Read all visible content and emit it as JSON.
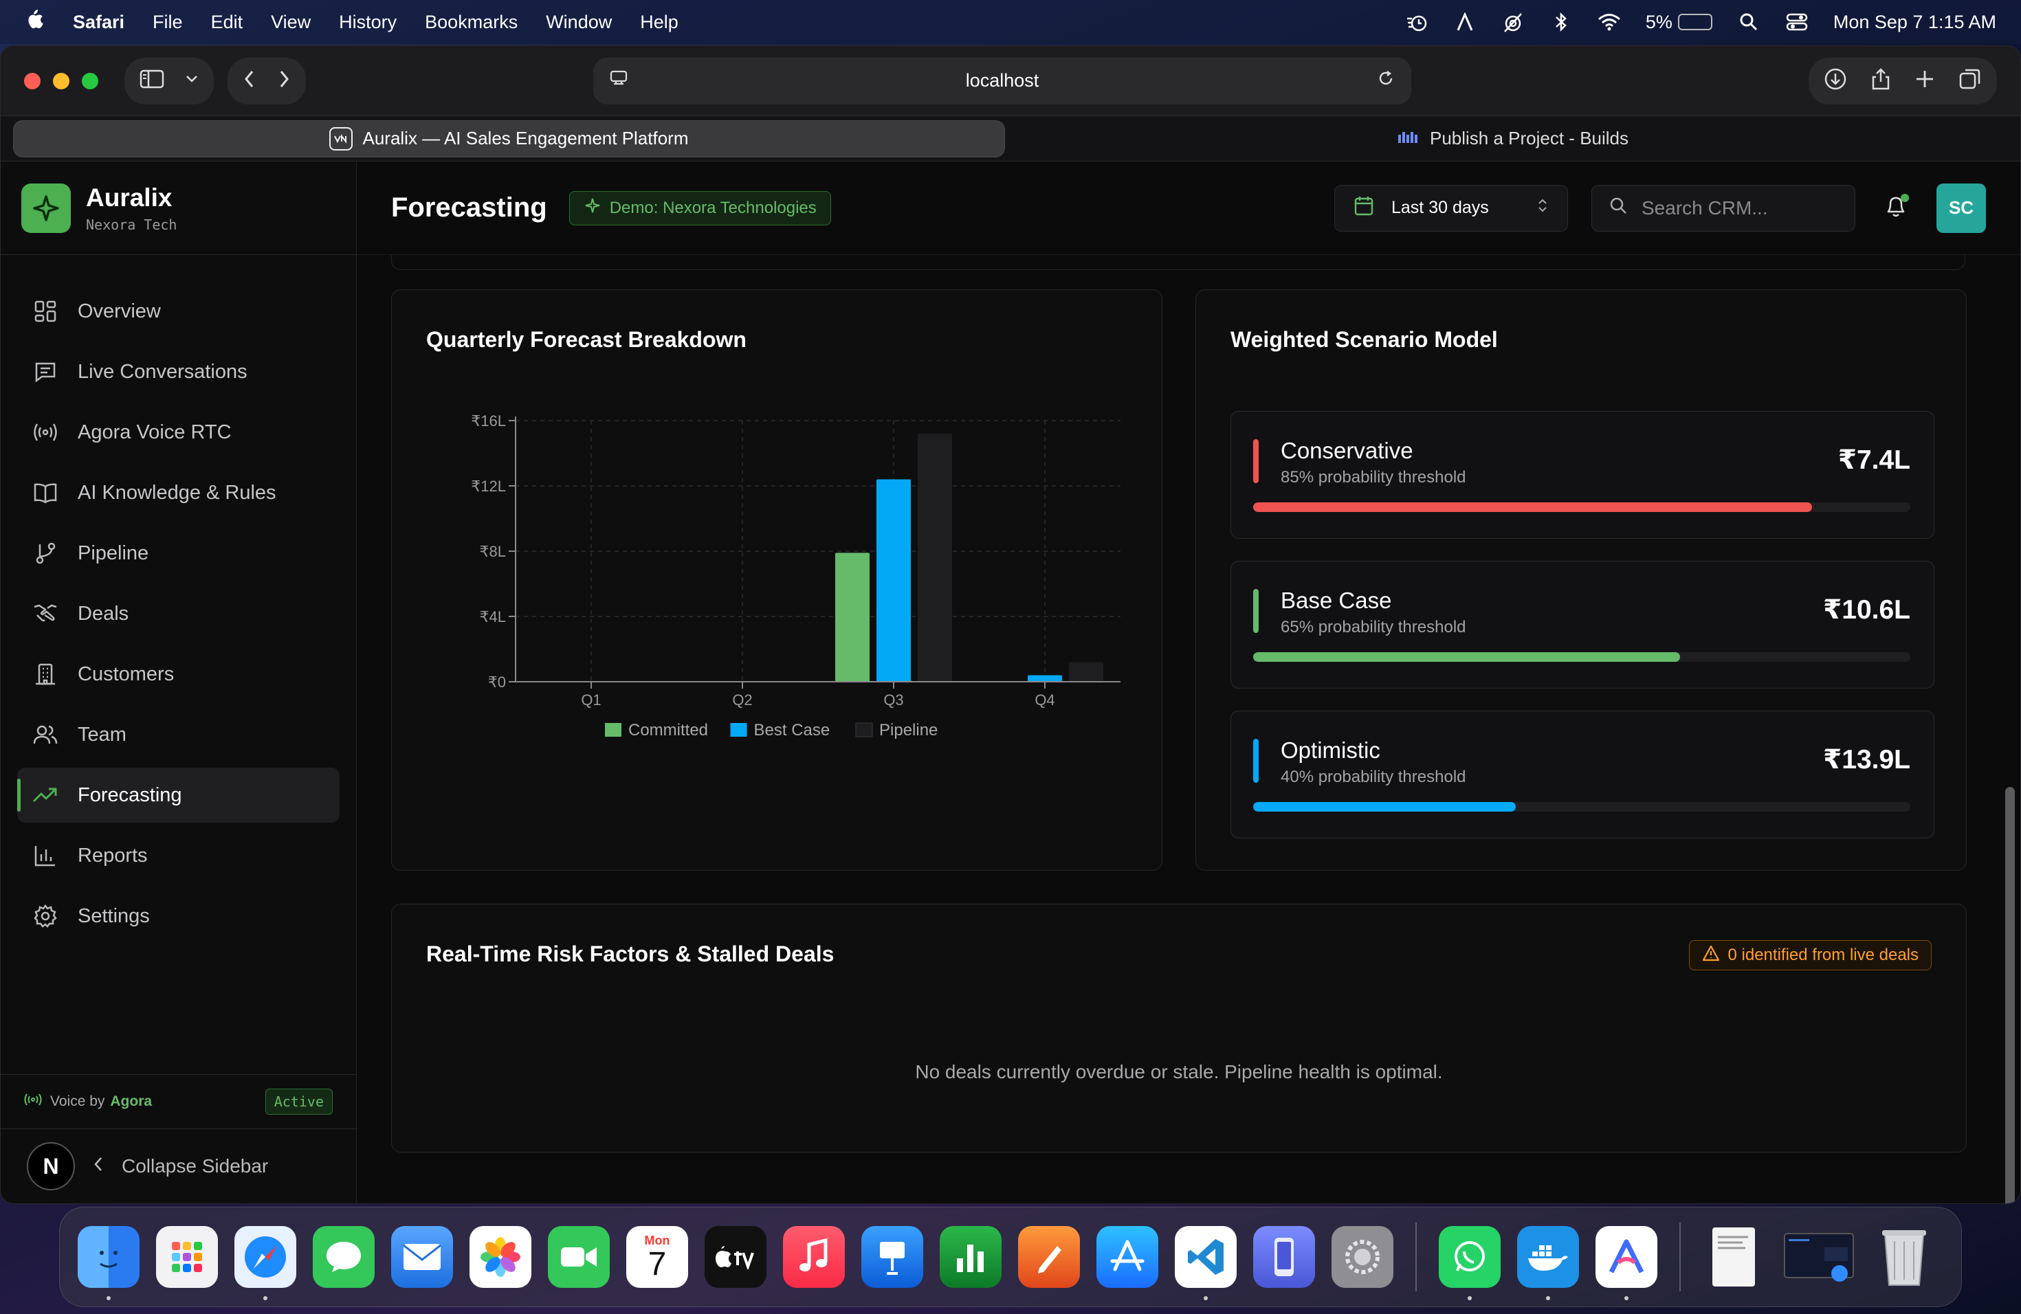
{
  "menubar": {
    "app": "Safari",
    "items": [
      "File",
      "Edit",
      "View",
      "History",
      "Bookmarks",
      "Window",
      "Help"
    ],
    "battery_percent": "5%",
    "battery_level": 0.05,
    "datetime": "Mon Sep 7  1:15 AM"
  },
  "browser": {
    "url": "localhost",
    "tabs": [
      {
        "label": "Auralix — AI Sales Engagement Platform",
        "active": true
      },
      {
        "label": "Publish a Project - Builds",
        "active": false
      }
    ]
  },
  "brand": {
    "name": "Auralix",
    "sub": "Nexora Tech"
  },
  "nav": {
    "items": [
      {
        "label": "Overview",
        "icon": "grid-icon"
      },
      {
        "label": "Live Conversations",
        "icon": "chat-icon"
      },
      {
        "label": "Agora Voice RTC",
        "icon": "broadcast-icon"
      },
      {
        "label": "AI Knowledge & Rules",
        "icon": "book-icon"
      },
      {
        "label": "Pipeline",
        "icon": "branch-icon"
      },
      {
        "label": "Deals",
        "icon": "handshake-icon"
      },
      {
        "label": "Customers",
        "icon": "building-icon"
      },
      {
        "label": "Team",
        "icon": "users-icon"
      },
      {
        "label": "Forecasting",
        "icon": "trend-icon",
        "active": true
      },
      {
        "label": "Reports",
        "icon": "bar-chart-icon"
      },
      {
        "label": "Settings",
        "icon": "gear-icon"
      }
    ]
  },
  "voice": {
    "prefix": "Voice by",
    "provider": "Agora",
    "status": "Active"
  },
  "collapse": {
    "avatar": "N",
    "label": "Collapse Sidebar"
  },
  "header": {
    "title": "Forecasting",
    "demo_badge": "Demo: Nexora Technologies",
    "date_range": "Last 30 days",
    "search_placeholder": "Search CRM...",
    "avatar": "SC"
  },
  "quarterly": {
    "title": "Quarterly Forecast Breakdown"
  },
  "chart_data": {
    "type": "bar",
    "title": "Quarterly Forecast Breakdown",
    "categories": [
      "Q1",
      "Q2",
      "Q3",
      "Q4"
    ],
    "series": [
      {
        "name": "Committed",
        "values": [
          0,
          0,
          7.9,
          0
        ],
        "color": "#66bb6a"
      },
      {
        "name": "Best Case",
        "values": [
          0,
          0,
          12.4,
          0.4
        ],
        "color": "#03a9f4"
      },
      {
        "name": "Pipeline",
        "values": [
          0,
          0,
          15.2,
          1.2
        ],
        "color": "#1e1e20"
      }
    ],
    "yticks": [
      "₹0",
      "₹4L",
      "₹8L",
      "₹12L",
      "₹16L"
    ],
    "ylim": [
      0,
      16
    ],
    "grid": true,
    "legend": "bottom"
  },
  "scenarios": {
    "title": "Weighted Scenario Model",
    "items": [
      {
        "name": "Conservative",
        "sub": "85% probability threshold",
        "value": "₹7.4L",
        "fill": 0.85,
        "color": "#ef5350"
      },
      {
        "name": "Base Case",
        "sub": "65% probability threshold",
        "value": "₹10.6L",
        "fill": 0.65,
        "color": "#66bb6a"
      },
      {
        "name": "Optimistic",
        "sub": "40% probability threshold",
        "value": "₹13.9L",
        "fill": 0.4,
        "color": "#03a9f4"
      }
    ]
  },
  "risk": {
    "title": "Real-Time Risk Factors & Stalled Deals",
    "badge": "0 identified from live deals",
    "empty": "No deals currently overdue or stale. Pipeline health is optimal."
  },
  "dock": {
    "calendar_month": "Mon",
    "calendar_day": "7",
    "apps": [
      "finder-icon",
      "launchpad-icon",
      "safari-icon",
      "messages-icon",
      "mail-icon",
      "photos-icon",
      "facetime-icon",
      "calendar-icon",
      "tv-icon",
      "music-icon",
      "keynote-icon",
      "numbers-icon",
      "pages-icon",
      "app-store-icon",
      "vscode-icon",
      "simulator-icon",
      "system-settings-icon",
      "whatsapp-icon",
      "docker-icon",
      "auralix-app-icon",
      "document-icon",
      "screenshot-icon",
      "trash-icon"
    ]
  }
}
